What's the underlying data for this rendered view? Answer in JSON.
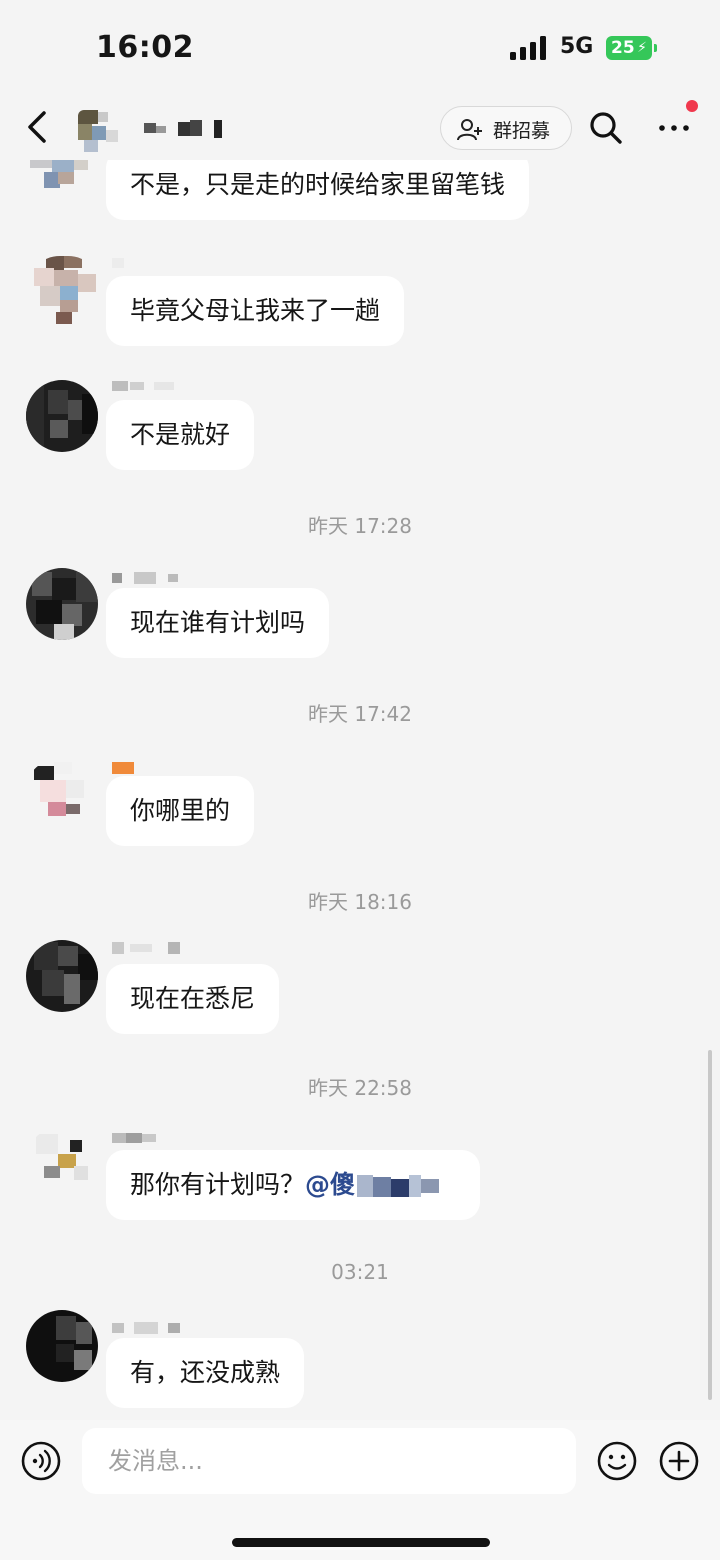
{
  "status_bar": {
    "time": "16:02",
    "network": "5G",
    "battery": "25"
  },
  "header": {
    "recruit_label": "群招募"
  },
  "messages": [
    {
      "text": "不是，只是走的时候给家里留笔钱"
    },
    {
      "text": "毕竟父母让我来了一趟"
    },
    {
      "text": "不是就好"
    },
    {
      "text": "现在谁有计划吗"
    },
    {
      "text": "你哪里的"
    },
    {
      "text": "现在在悉尼"
    },
    {
      "text": "那你有计划吗？",
      "mention": "@傻"
    },
    {
      "text": "有，还没成熟"
    }
  ],
  "timestamps": [
    "昨天 17:28",
    "昨天 17:42",
    "昨天 18:16",
    "昨天 22:58",
    "03:21"
  ],
  "input": {
    "placeholder": "发消息..."
  },
  "colors": {
    "background": "#f4f4f4",
    "bubble": "#ffffff",
    "battery": "#35c759",
    "notify_dot": "#f0384d",
    "mention": "#2c4a8f"
  }
}
